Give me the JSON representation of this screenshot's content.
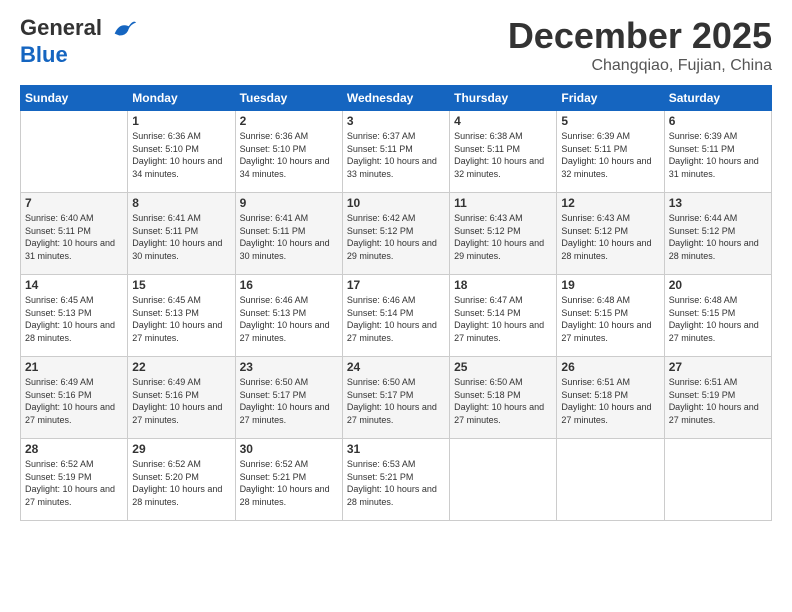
{
  "logo": {
    "line1": "General",
    "line2": "Blue"
  },
  "title": "December 2025",
  "subtitle": "Changqiao, Fujian, China",
  "days_of_week": [
    "Sunday",
    "Monday",
    "Tuesday",
    "Wednesday",
    "Thursday",
    "Friday",
    "Saturday"
  ],
  "weeks": [
    [
      {
        "day": "",
        "sunrise": "",
        "sunset": "",
        "daylight": ""
      },
      {
        "day": "1",
        "sunrise": "6:36 AM",
        "sunset": "5:10 PM",
        "daylight": "10 hours and 34 minutes."
      },
      {
        "day": "2",
        "sunrise": "6:36 AM",
        "sunset": "5:10 PM",
        "daylight": "10 hours and 34 minutes."
      },
      {
        "day": "3",
        "sunrise": "6:37 AM",
        "sunset": "5:11 PM",
        "daylight": "10 hours and 33 minutes."
      },
      {
        "day": "4",
        "sunrise": "6:38 AM",
        "sunset": "5:11 PM",
        "daylight": "10 hours and 32 minutes."
      },
      {
        "day": "5",
        "sunrise": "6:39 AM",
        "sunset": "5:11 PM",
        "daylight": "10 hours and 32 minutes."
      },
      {
        "day": "6",
        "sunrise": "6:39 AM",
        "sunset": "5:11 PM",
        "daylight": "10 hours and 31 minutes."
      }
    ],
    [
      {
        "day": "7",
        "sunrise": "6:40 AM",
        "sunset": "5:11 PM",
        "daylight": "10 hours and 31 minutes."
      },
      {
        "day": "8",
        "sunrise": "6:41 AM",
        "sunset": "5:11 PM",
        "daylight": "10 hours and 30 minutes."
      },
      {
        "day": "9",
        "sunrise": "6:41 AM",
        "sunset": "5:11 PM",
        "daylight": "10 hours and 30 minutes."
      },
      {
        "day": "10",
        "sunrise": "6:42 AM",
        "sunset": "5:12 PM",
        "daylight": "10 hours and 29 minutes."
      },
      {
        "day": "11",
        "sunrise": "6:43 AM",
        "sunset": "5:12 PM",
        "daylight": "10 hours and 29 minutes."
      },
      {
        "day": "12",
        "sunrise": "6:43 AM",
        "sunset": "5:12 PM",
        "daylight": "10 hours and 28 minutes."
      },
      {
        "day": "13",
        "sunrise": "6:44 AM",
        "sunset": "5:12 PM",
        "daylight": "10 hours and 28 minutes."
      }
    ],
    [
      {
        "day": "14",
        "sunrise": "6:45 AM",
        "sunset": "5:13 PM",
        "daylight": "10 hours and 28 minutes."
      },
      {
        "day": "15",
        "sunrise": "6:45 AM",
        "sunset": "5:13 PM",
        "daylight": "10 hours and 27 minutes."
      },
      {
        "day": "16",
        "sunrise": "6:46 AM",
        "sunset": "5:13 PM",
        "daylight": "10 hours and 27 minutes."
      },
      {
        "day": "17",
        "sunrise": "6:46 AM",
        "sunset": "5:14 PM",
        "daylight": "10 hours and 27 minutes."
      },
      {
        "day": "18",
        "sunrise": "6:47 AM",
        "sunset": "5:14 PM",
        "daylight": "10 hours and 27 minutes."
      },
      {
        "day": "19",
        "sunrise": "6:48 AM",
        "sunset": "5:15 PM",
        "daylight": "10 hours and 27 minutes."
      },
      {
        "day": "20",
        "sunrise": "6:48 AM",
        "sunset": "5:15 PM",
        "daylight": "10 hours and 27 minutes."
      }
    ],
    [
      {
        "day": "21",
        "sunrise": "6:49 AM",
        "sunset": "5:16 PM",
        "daylight": "10 hours and 27 minutes."
      },
      {
        "day": "22",
        "sunrise": "6:49 AM",
        "sunset": "5:16 PM",
        "daylight": "10 hours and 27 minutes."
      },
      {
        "day": "23",
        "sunrise": "6:50 AM",
        "sunset": "5:17 PM",
        "daylight": "10 hours and 27 minutes."
      },
      {
        "day": "24",
        "sunrise": "6:50 AM",
        "sunset": "5:17 PM",
        "daylight": "10 hours and 27 minutes."
      },
      {
        "day": "25",
        "sunrise": "6:50 AM",
        "sunset": "5:18 PM",
        "daylight": "10 hours and 27 minutes."
      },
      {
        "day": "26",
        "sunrise": "6:51 AM",
        "sunset": "5:18 PM",
        "daylight": "10 hours and 27 minutes."
      },
      {
        "day": "27",
        "sunrise": "6:51 AM",
        "sunset": "5:19 PM",
        "daylight": "10 hours and 27 minutes."
      }
    ],
    [
      {
        "day": "28",
        "sunrise": "6:52 AM",
        "sunset": "5:19 PM",
        "daylight": "10 hours and 27 minutes."
      },
      {
        "day": "29",
        "sunrise": "6:52 AM",
        "sunset": "5:20 PM",
        "daylight": "10 hours and 28 minutes."
      },
      {
        "day": "30",
        "sunrise": "6:52 AM",
        "sunset": "5:21 PM",
        "daylight": "10 hours and 28 minutes."
      },
      {
        "day": "31",
        "sunrise": "6:53 AM",
        "sunset": "5:21 PM",
        "daylight": "10 hours and 28 minutes."
      },
      {
        "day": "",
        "sunrise": "",
        "sunset": "",
        "daylight": ""
      },
      {
        "day": "",
        "sunrise": "",
        "sunset": "",
        "daylight": ""
      },
      {
        "day": "",
        "sunrise": "",
        "sunset": "",
        "daylight": ""
      }
    ]
  ]
}
